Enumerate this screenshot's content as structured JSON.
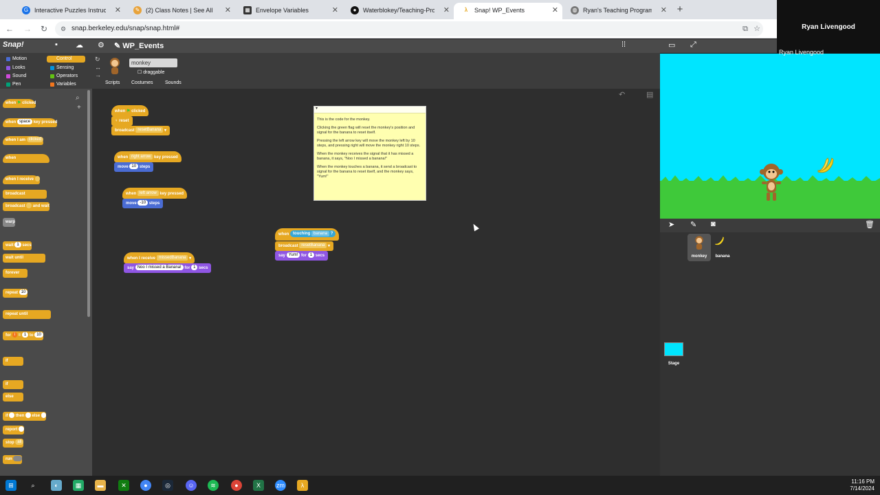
{
  "browser": {
    "tabs": [
      {
        "label": "Interactive Puzzles Instruction",
        "active": false
      },
      {
        "label": "(2) Class Notes | See All",
        "active": false
      },
      {
        "label": "Envelope Variables",
        "active": false
      },
      {
        "label": "Waterblokey/Teaching-Program",
        "active": false
      },
      {
        "label": "Snap! WP_Events",
        "active": true
      },
      {
        "label": "Ryan's Teaching Programming",
        "active": false
      }
    ],
    "new_tab": "+",
    "url": "snap.berkeley.edu/snap/snap.html#"
  },
  "video": {
    "name": "Ryan Livengood",
    "label": "Ryan Livengood"
  },
  "snap": {
    "logo": "Snap!",
    "project_name": "WP_Events",
    "categories": [
      {
        "label": "Motion",
        "color": "#4a6cd4"
      },
      {
        "label": "Control",
        "color": "#e6a822"
      },
      {
        "label": "Looks",
        "color": "#8f56e3"
      },
      {
        "label": "Sensing",
        "color": "#0494dc"
      },
      {
        "label": "Sound",
        "color": "#cf4ad9"
      },
      {
        "label": "Operators",
        "color": "#62c213"
      },
      {
        "label": "Pen",
        "color": "#00a178"
      },
      {
        "label": "Variables",
        "color": "#f3761d"
      }
    ],
    "selected_category": "Control",
    "palette_blocks": [
      {
        "label": "when",
        "after": "clicked"
      },
      {
        "label": "when",
        "slot": "space",
        "after": "key pressed"
      },
      {
        "label": "when I am",
        "slot": "clicked"
      },
      {
        "label": "when"
      },
      {
        "label": "when I receive"
      },
      {
        "label": "broadcast"
      },
      {
        "label": "broadcast",
        "after": "and wait"
      },
      {
        "label": "warp"
      },
      {
        "label": "wait",
        "slot": "1",
        "after": "secs"
      },
      {
        "label": "wait until"
      },
      {
        "label": "forever"
      },
      {
        "label": "repeat",
        "slot": "10"
      },
      {
        "label": "repeat until"
      },
      {
        "label": "for",
        "slot": "1",
        "after": "to",
        "slot2": "10"
      },
      {
        "label": "if"
      },
      {
        "label": "if"
      },
      {
        "label": "else"
      },
      {
        "label": "if",
        "after": "then",
        "after2": "else"
      },
      {
        "label": "report"
      },
      {
        "label": "stop",
        "slot": "all"
      },
      {
        "label": "run"
      }
    ],
    "sprite": {
      "name": "monkey",
      "draggable": "draggable"
    },
    "sprite_tabs": [
      "Scripts",
      "Costumes",
      "Sounds"
    ],
    "scripts": {
      "s1_hat": "when",
      "s1_hat_after": "clicked",
      "s1_b1": "reset",
      "s1_b2": "broadcast",
      "s1_b2_dd": "resetBanana",
      "s2_hat": "when",
      "s2_key": "right arrow",
      "s2_after": "key pressed",
      "s2_b1": "move",
      "s2_b1_slot": "10",
      "s2_b1_after": "steps",
      "s3_hat": "when",
      "s3_key": "left arrow",
      "s3_after": "key pressed",
      "s3_b1": "move",
      "s3_b1_slot": "-10",
      "s3_b1_after": "steps",
      "s4_hat": "when",
      "s4_pred": "touching",
      "s4_pred_dd": "banana",
      "s4_pred_q": "?",
      "s4_b1": "broadcast",
      "s4_b1_dd": "resetBanana",
      "s4_b2": "say",
      "s4_b2_slot": "Yum!",
      "s4_b2_for": "for",
      "s4_b2_n": "1",
      "s4_b2_secs": "secs",
      "s5_hat": "when I receive",
      "s5_dd": "missedBanana",
      "s5_b1": "say",
      "s5_b1_slot": "Noo I missed a Banana!",
      "s5_b1_for": "for",
      "s5_b1_n": "1",
      "s5_b1_secs": "secs"
    },
    "comment": {
      "p1": "This is the code for the monkey.",
      "p2": "Clicking the green flag will reset the monkey's position and signal for the banana to reset itself.",
      "p3": "Pressing the left arrow key will move the monkey left by 10 steps, and pressing right will move the monkey right 10 steps.",
      "p4": "When the monkey receives the signal that it has missed a banana, it says, \"Noo I missed a banana!\"",
      "p5": "When the monkey touches a banana, it send a broadcast to signal for the banana to reset itself, and the monkey says, \"Yum!\""
    },
    "corral": {
      "sprites": [
        "monkey",
        "banana"
      ],
      "stage": "Stage"
    }
  },
  "taskbar": {
    "time": "11:16 PM",
    "date": "7/14/2024"
  }
}
